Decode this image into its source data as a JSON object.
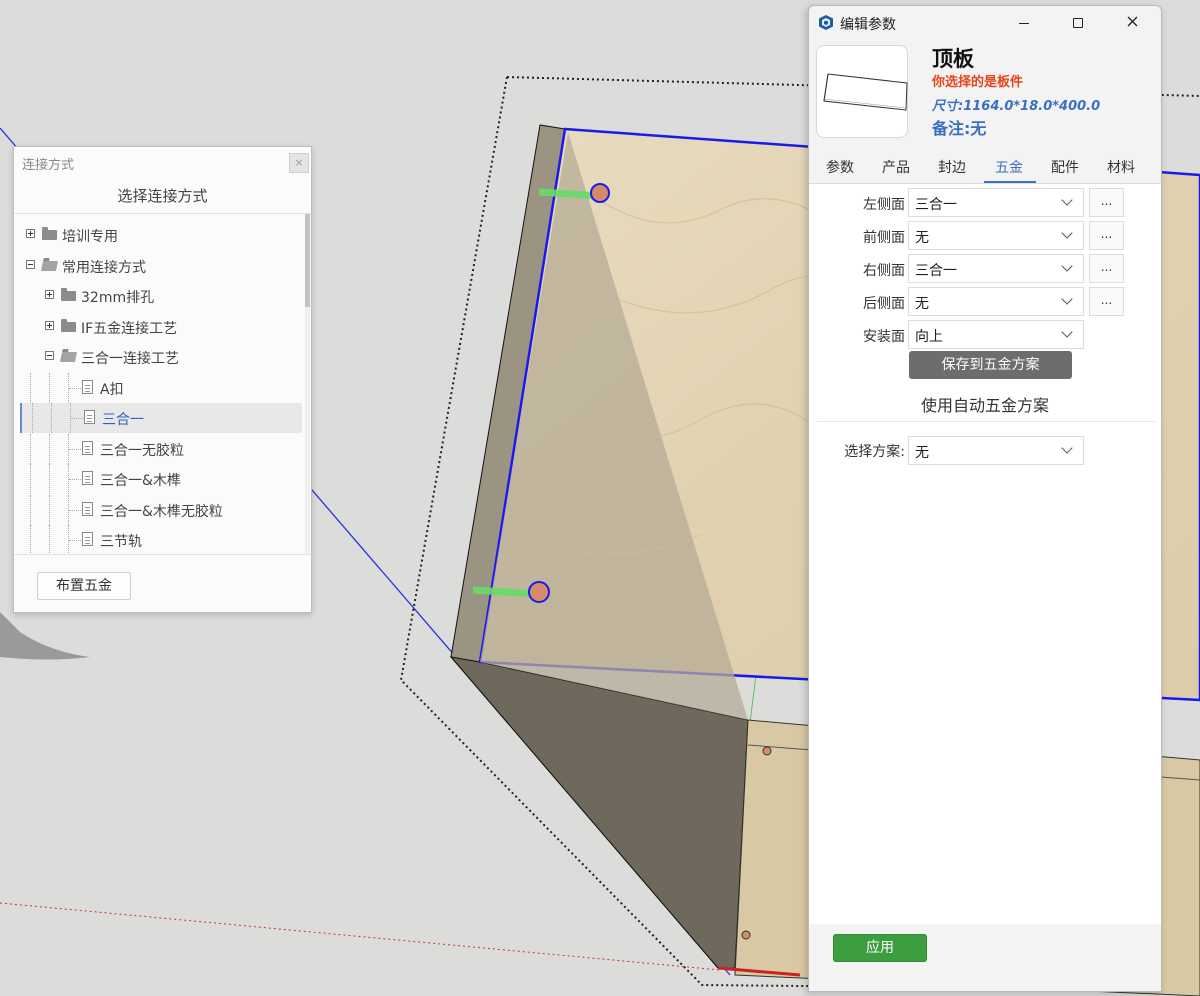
{
  "connection_panel": {
    "title": "连接方式",
    "close_glyph": "×",
    "heading": "选择连接方式",
    "tree": [
      {
        "label": "培训专用",
        "level": 0,
        "kind": "folder",
        "expanded": false
      },
      {
        "label": "常用连接方式",
        "level": 0,
        "kind": "folder",
        "expanded": true
      },
      {
        "label": "32mm排孔",
        "level": 1,
        "kind": "folder",
        "expanded": false
      },
      {
        "label": "IF五金连接工艺",
        "level": 1,
        "kind": "folder",
        "expanded": false
      },
      {
        "label": "三合一连接工艺",
        "level": 1,
        "kind": "folder",
        "expanded": true
      },
      {
        "label": "A扣",
        "level": 2,
        "kind": "doc"
      },
      {
        "label": "三合一",
        "level": 2,
        "kind": "doc",
        "selected": true
      },
      {
        "label": "三合一无胶粒",
        "level": 2,
        "kind": "doc"
      },
      {
        "label": "三合一&木榫",
        "level": 2,
        "kind": "doc"
      },
      {
        "label": "三合一&木榫无胶粒",
        "level": 2,
        "kind": "doc"
      },
      {
        "label": "三节轨",
        "level": 2,
        "kind": "doc"
      }
    ],
    "layout_button": "布置五金"
  },
  "dialog": {
    "title": "编辑参数",
    "part_name": "顶板",
    "part_hint": "你选择的是板件",
    "part_size": "尺寸:1164.0*18.0*400.0",
    "part_note": "备注:无",
    "tabs": [
      "参数",
      "产品",
      "封边",
      "五金",
      "配件",
      "材料"
    ],
    "active_tab": "五金",
    "fields": [
      {
        "label": "左侧面",
        "value": "三合一",
        "has_more": true
      },
      {
        "label": "前侧面",
        "value": "无",
        "has_more": true
      },
      {
        "label": "右侧面",
        "value": "三合一",
        "has_more": true
      },
      {
        "label": "后侧面",
        "value": "无",
        "has_more": true
      },
      {
        "label": "安装面",
        "value": "向上",
        "has_more": false
      }
    ],
    "more_glyph": "...",
    "save_button": "保存到五金方案",
    "auto_section_title": "使用自动五金方案",
    "scheme": {
      "label": "选择方案:",
      "value": "无"
    },
    "apply_button": "应用"
  },
  "colors": {
    "accent": "#3b6fc0",
    "hint_red": "#e8441c",
    "apply_green": "#3c9e3f",
    "save_gray": "#6d6d6d",
    "selection_blue": "#0000ff",
    "wood": "#e4d6b9"
  },
  "icons": {
    "app": "sketchup-logo-icon",
    "tree_folder": "folder-icon",
    "tree_doc": "document-icon",
    "dropdown": "chevron-down-icon",
    "window": [
      "minimize-icon",
      "maximize-icon",
      "close-icon"
    ]
  }
}
